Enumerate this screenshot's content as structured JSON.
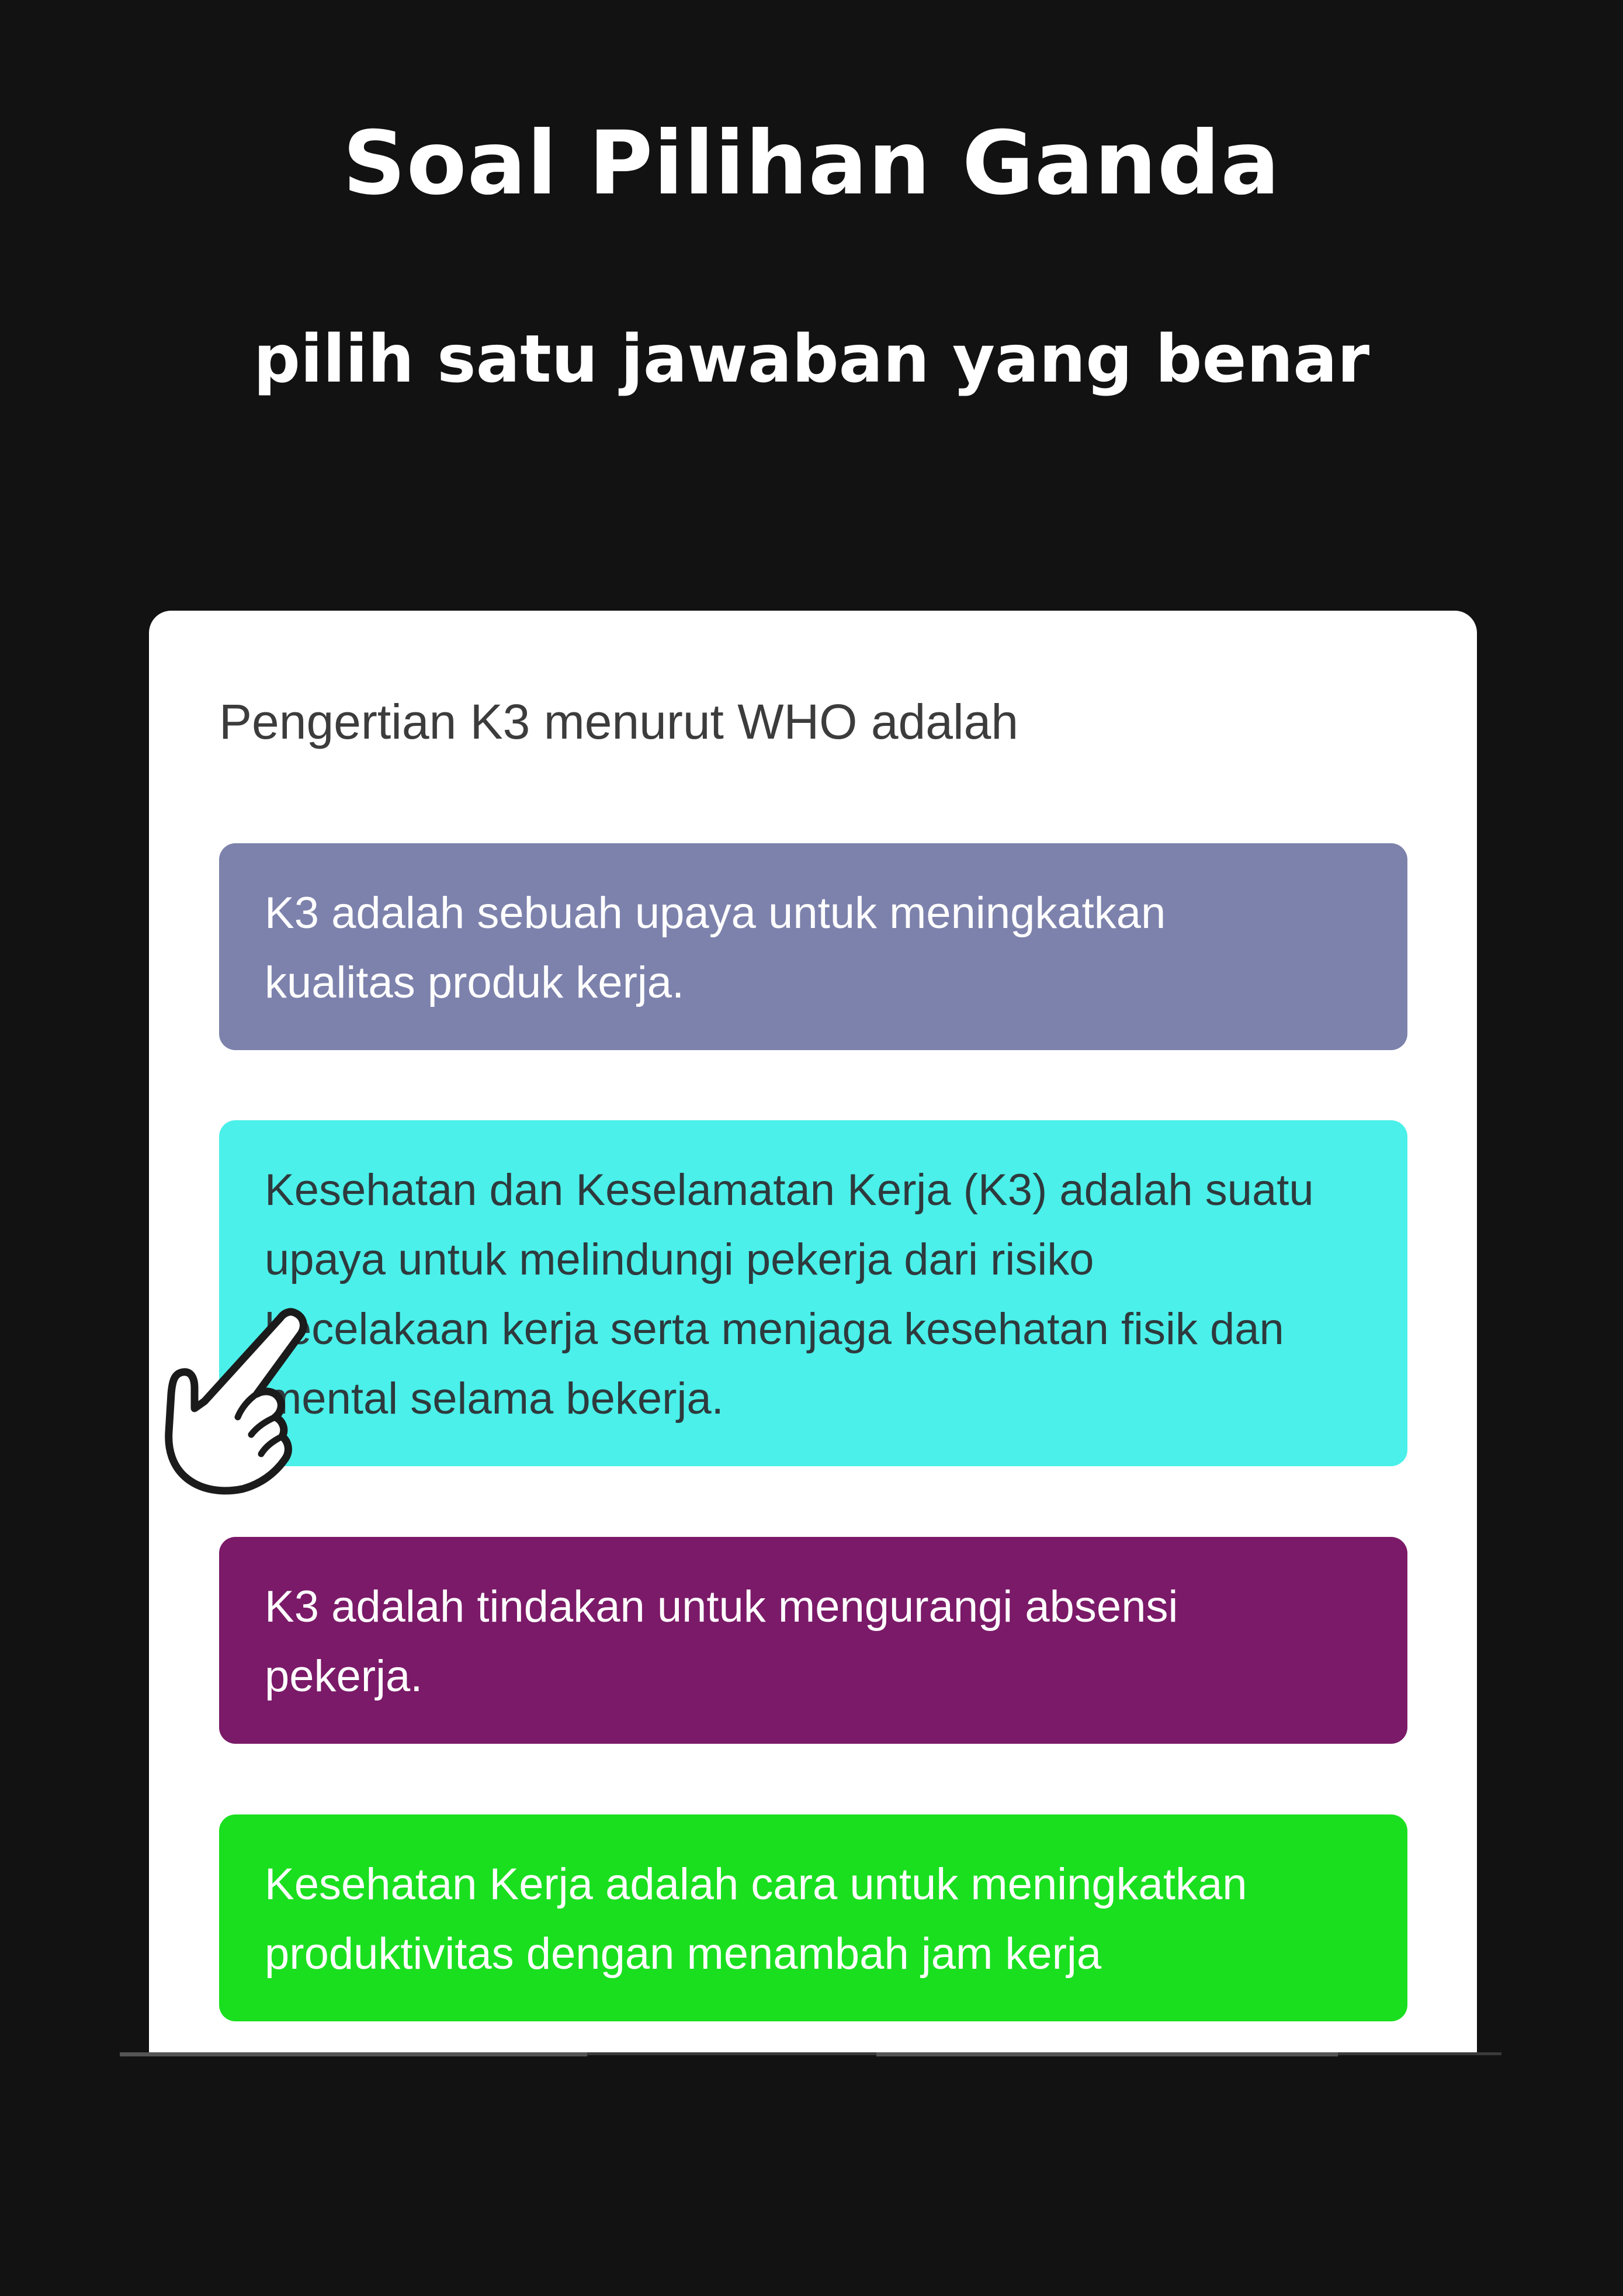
{
  "header": {
    "title": "Soal Pilihan Ganda",
    "subtitle": "pilih satu jawaban yang benar"
  },
  "quiz": {
    "question": "Pengertian K3 menurut WHO adalah",
    "options": [
      {
        "lines": [
          "K3 adalah sebuah upaya untuk meningkatkan",
          "kualitas produk kerja."
        ],
        "color": "#7d82ac"
      },
      {
        "lines": [
          "Kesehatan dan Keselamatan Kerja (K3) adalah suatu",
          "upaya untuk melindungi pekerja dari risiko",
          "kecelakaan kerja serta menjaga kesehatan fisik dan",
          "mental selama bekerja."
        ],
        "color": "#4af0e9"
      },
      {
        "lines": [
          "K3 adalah tindakan untuk mengurangi absensi",
          "pekerja."
        ],
        "color": "#7b1a68"
      },
      {
        "lines": [
          "Kesehatan Kerja adalah cara untuk meningkatkan",
          "produktivitas dengan menambah jam kerja"
        ],
        "color": "#1adf1f"
      }
    ]
  },
  "pointer": {
    "icon": "hand-pointer-icon",
    "target_option": 2
  },
  "colors": {
    "background": "#121212",
    "card": "#ffffff",
    "title_text": "#ffffff"
  }
}
